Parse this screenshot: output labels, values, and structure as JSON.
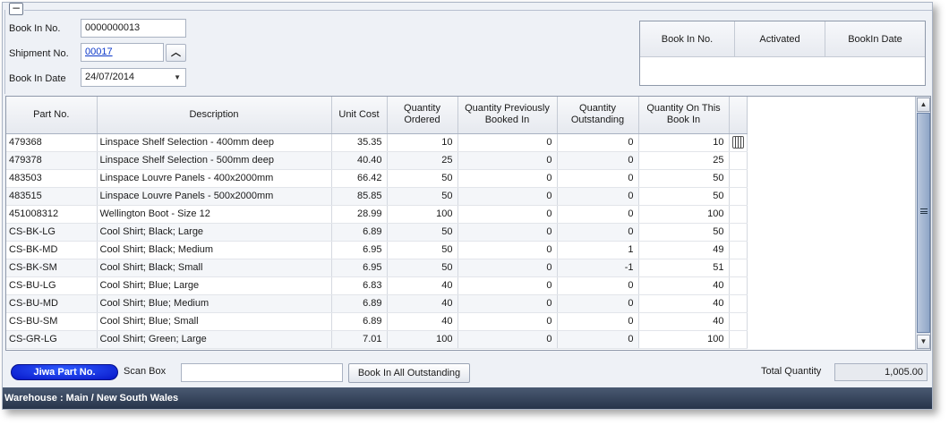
{
  "header": {
    "collapse_symbol": "−",
    "book_in_no_label": "Book In No.",
    "book_in_no_value": "0000000013",
    "shipment_no_label": "Shipment No.",
    "shipment_no_value": "00017",
    "book_in_date_label": "Book In Date",
    "book_in_date_value": "24/07/2014"
  },
  "mini_grid": {
    "columns": [
      "Book In No.",
      "Activated",
      "BookIn Date"
    ]
  },
  "grid": {
    "columns": [
      "Part No.",
      "Description",
      "Unit Cost",
      "Quantity Ordered",
      "Quantity Previously Booked In",
      "Quantity Outstanding",
      "Quantity On This Book In"
    ],
    "rows": [
      [
        "479368",
        "Linspace Shelf Selection - 400mm deep",
        "35.35",
        "10",
        "0",
        "0",
        "10"
      ],
      [
        "479378",
        "Linspace Shelf Selection - 500mm deep",
        "40.40",
        "25",
        "0",
        "0",
        "25"
      ],
      [
        "483503",
        "Linspace Louvre Panels - 400x2000mm",
        "66.42",
        "50",
        "0",
        "0",
        "50"
      ],
      [
        "483515",
        "Linspace Louvre Panels - 500x2000mm",
        "85.85",
        "50",
        "0",
        "0",
        "50"
      ],
      [
        "451008312",
        "Wellington Boot - Size 12",
        "28.99",
        "100",
        "0",
        "0",
        "100"
      ],
      [
        "CS-BK-LG",
        "Cool Shirt; Black; Large",
        "6.89",
        "50",
        "0",
        "0",
        "50"
      ],
      [
        "CS-BK-MD",
        "Cool Shirt; Black; Medium",
        "6.95",
        "50",
        "0",
        "1",
        "49"
      ],
      [
        "CS-BK-SM",
        "Cool Shirt; Black; Small",
        "6.95",
        "50",
        "0",
        "-1",
        "51"
      ],
      [
        "CS-BU-LG",
        "Cool Shirt; Blue; Large",
        "6.83",
        "40",
        "0",
        "0",
        "40"
      ],
      [
        "CS-BU-MD",
        "Cool Shirt; Blue; Medium",
        "6.89",
        "40",
        "0",
        "0",
        "40"
      ],
      [
        "CS-BU-SM",
        "Cool Shirt; Blue; Small",
        "6.89",
        "40",
        "0",
        "0",
        "40"
      ],
      [
        "CS-GR-LG",
        "Cool Shirt; Green; Large",
        "7.01",
        "100",
        "0",
        "0",
        "100"
      ]
    ]
  },
  "bottom": {
    "pill_label": "Jiwa Part No.",
    "scan_label": "Scan Box",
    "scan_value": "",
    "book_all_label": "Book In All Outstanding",
    "total_label": "Total Quantity",
    "total_value": "1,005.00"
  },
  "status_bar": "Warehouse : Main / New South Wales"
}
